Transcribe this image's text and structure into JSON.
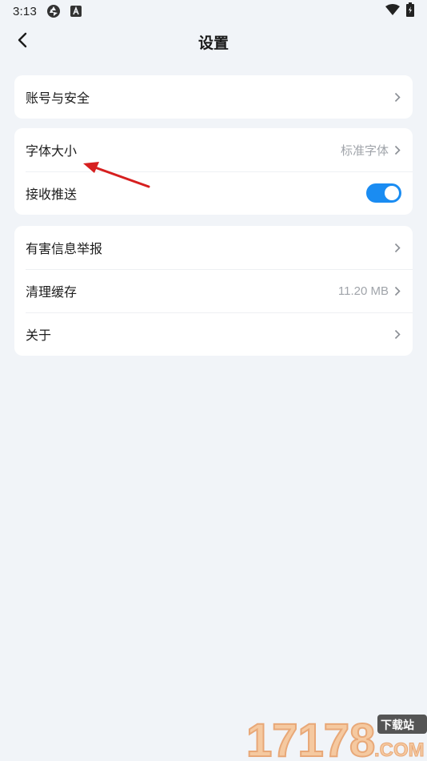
{
  "status_bar": {
    "time": "3:13",
    "icons": [
      "aperture-icon",
      "a-badge-icon",
      "wifi-icon",
      "battery-icon"
    ]
  },
  "header": {
    "back_icon": "chevron-left-icon",
    "title": "设置"
  },
  "groups": [
    {
      "rows": [
        {
          "label": "账号与安全",
          "value": "",
          "control": "chevron"
        }
      ]
    },
    {
      "rows": [
        {
          "label": "字体大小",
          "value": "标准字体",
          "control": "chevron"
        },
        {
          "label": "接收推送",
          "value": "",
          "control": "toggle",
          "toggle_on": true
        }
      ]
    },
    {
      "rows": [
        {
          "label": "有害信息举报",
          "value": "",
          "control": "chevron"
        },
        {
          "label": "清理缓存",
          "value": "11.20 MB",
          "control": "chevron"
        },
        {
          "label": "关于",
          "value": "",
          "control": "chevron"
        }
      ]
    }
  ],
  "annotation": {
    "color": "#d61f1f",
    "icon": "red-arrow-icon"
  },
  "watermark": {
    "text": "17178",
    "suffix": ".COM",
    "badge": "下载站"
  },
  "colors": {
    "background": "#f1f4f8",
    "card": "#ffffff",
    "accent": "#1a8cf2",
    "secondary_text": "#a0a4aa"
  }
}
